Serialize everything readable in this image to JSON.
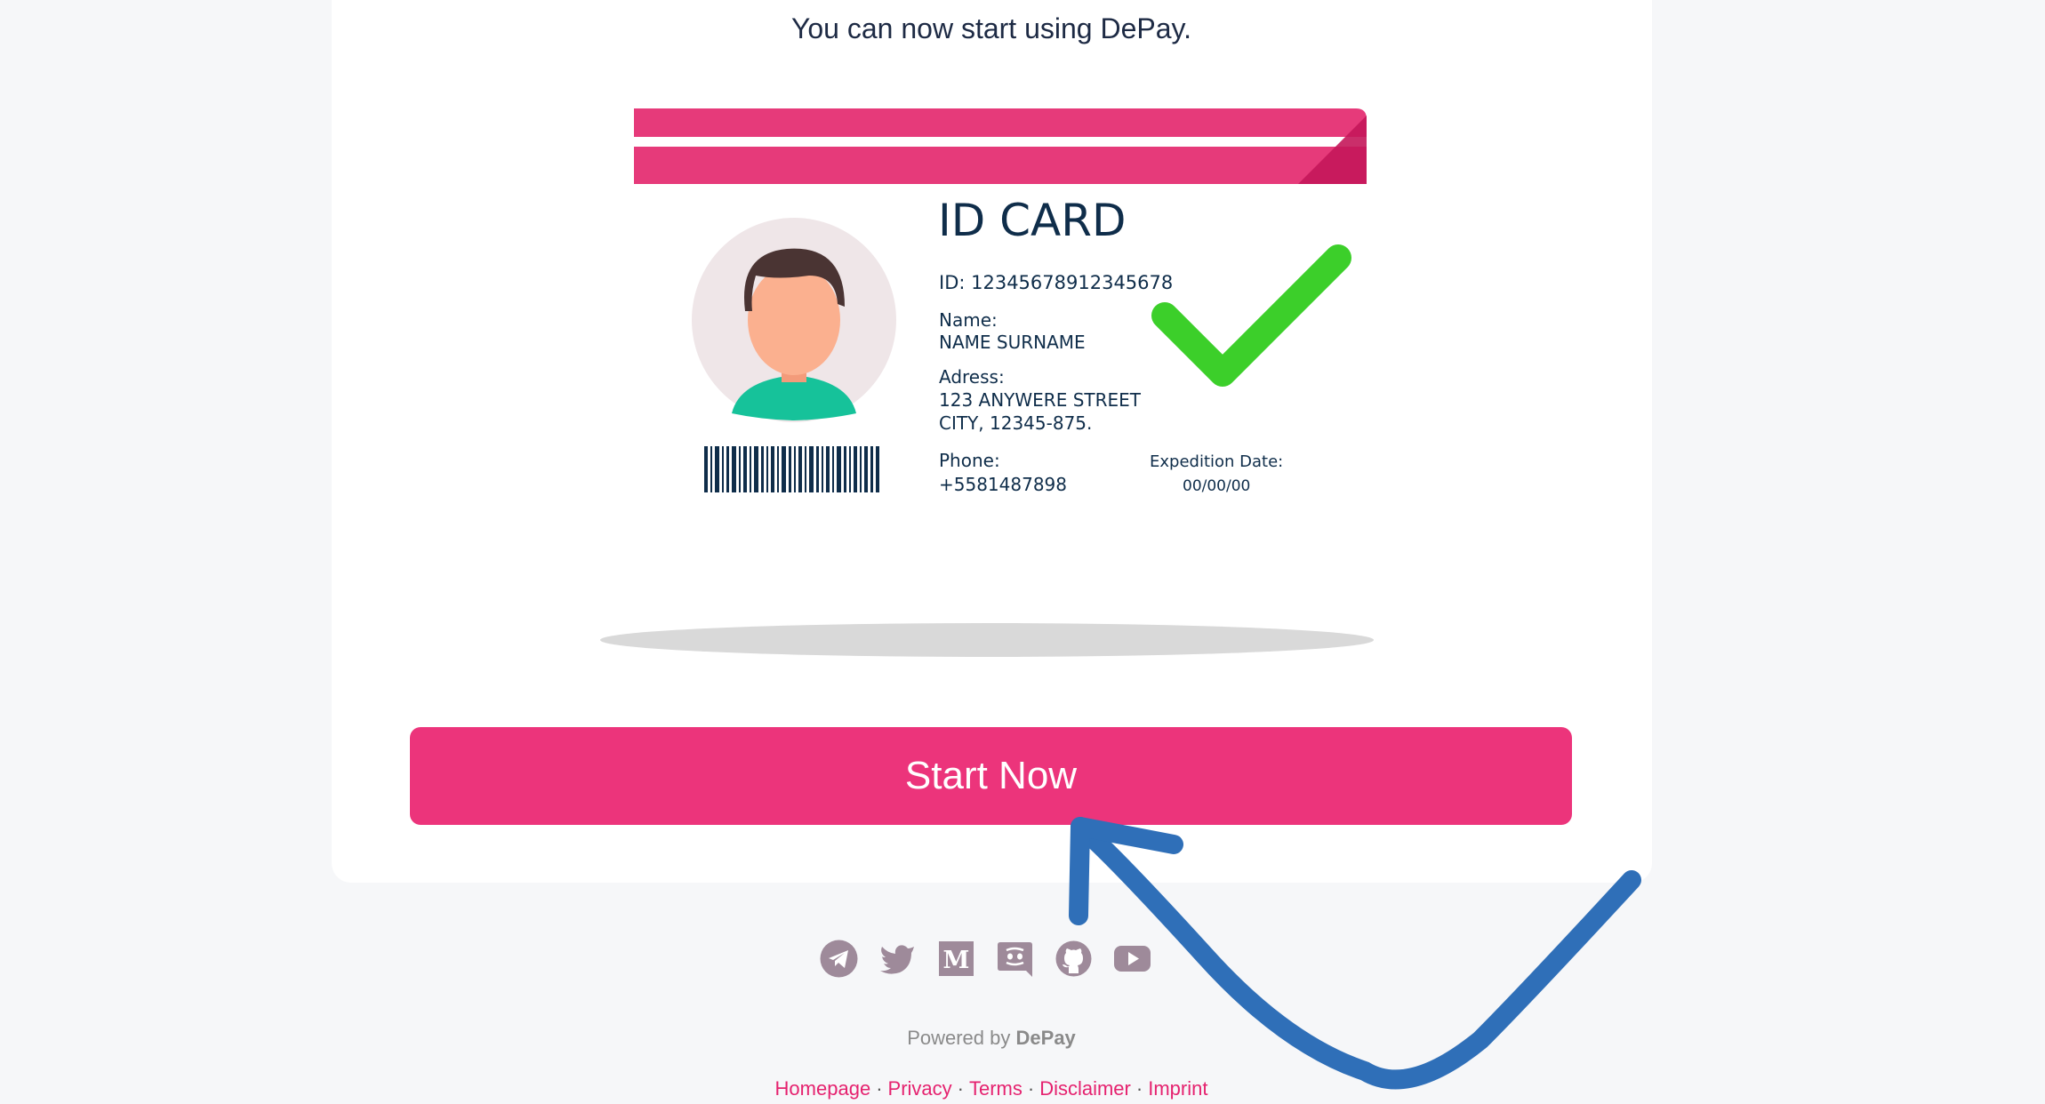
{
  "headline": "You can now start using DePay.",
  "id_card": {
    "title": "ID CARD",
    "id_line": "ID: 12345678912345678",
    "name_label": "Name:",
    "name_value": "NAME SURNAME",
    "address_label": "Adress:",
    "address_line1": "123 ANYWERE STREET",
    "address_line2": "CITY, 12345-875.",
    "phone_label": "Phone:",
    "phone_value": "+5581487898",
    "expedition_label": "Expedition  Date:",
    "expedition_value": "00/00/00"
  },
  "cta_label": "Start Now",
  "social_icons": [
    "telegram-icon",
    "twitter-icon",
    "medium-icon",
    "discord-icon",
    "github-icon",
    "youtube-icon"
  ],
  "footer": {
    "powered_prefix": "Powered by",
    "powered_brand": "DePay",
    "links": [
      "Homepage",
      "Privacy",
      "Terms",
      "Disclaimer",
      "Imprint"
    ]
  },
  "colors": {
    "accent": "#ec347b",
    "link": "#e5226f",
    "card_stripe": "#e63a7a",
    "checkmark": "#3ccf2a",
    "arrow": "#2f6fb8",
    "icon": "#9e8a9a"
  }
}
